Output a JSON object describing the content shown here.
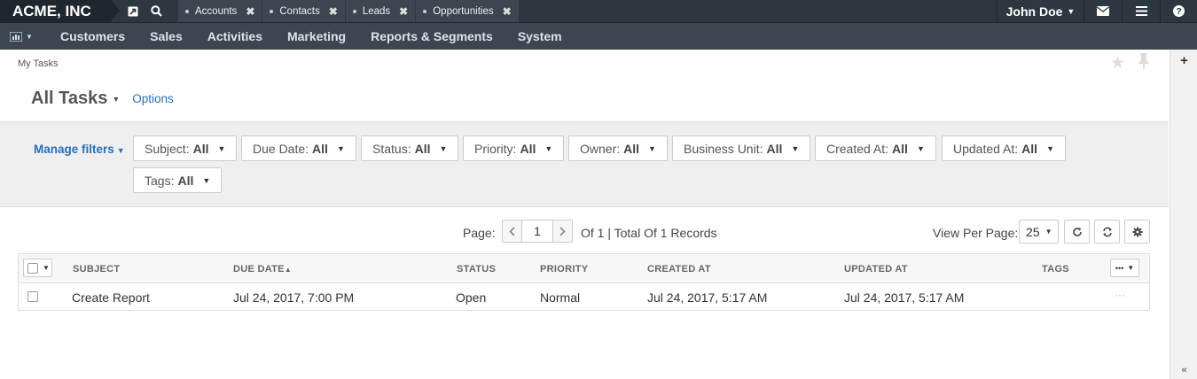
{
  "topbar": {
    "brand": "ACME, INC",
    "quick_icons": [
      "external-link-icon",
      "search-icon"
    ],
    "tabs": [
      {
        "label": "Accounts"
      },
      {
        "label": "Contacts"
      },
      {
        "label": "Leads"
      },
      {
        "label": "Opportunities"
      }
    ],
    "user_name": "John Doe",
    "right_icons": [
      "envelope-icon",
      "menu-icon",
      "help-icon"
    ]
  },
  "mainnav": {
    "items": [
      "Customers",
      "Sales",
      "Activities",
      "Marketing",
      "Reports & Segments",
      "System"
    ]
  },
  "breadcrumb": "My Tasks",
  "title": "All Tasks",
  "options_label": "Options",
  "filters": {
    "manage_label": "Manage filters",
    "items": [
      {
        "label": "Subject:",
        "value": "All"
      },
      {
        "label": "Due Date:",
        "value": "All"
      },
      {
        "label": "Status:",
        "value": "All"
      },
      {
        "label": "Priority:",
        "value": "All"
      },
      {
        "label": "Owner:",
        "value": "All"
      },
      {
        "label": "Business Unit:",
        "value": "All"
      },
      {
        "label": "Created At:",
        "value": "All"
      },
      {
        "label": "Updated At:",
        "value": "All"
      },
      {
        "label": "Tags:",
        "value": "All"
      }
    ]
  },
  "pagination": {
    "page_label": "Page:",
    "page": "1",
    "total_text": "Of 1 | Total Of 1 Records",
    "view_per_page_label": "View Per Page:",
    "per_page": "25"
  },
  "grid": {
    "columns": [
      "SUBJECT",
      "DUE DATE",
      "STATUS",
      "PRIORITY",
      "CREATED AT",
      "UPDATED AT",
      "TAGS"
    ],
    "sort_indicator": "▲",
    "rows": [
      {
        "subject": "Create Report",
        "due_date": "Jul 24, 2017, 7:00 PM",
        "status": "Open",
        "priority": "Normal",
        "created_at": "Jul 24, 2017, 5:17 AM",
        "updated_at": "Jul 24, 2017, 5:17 AM",
        "tags": "",
        "actions": "···"
      }
    ]
  }
}
